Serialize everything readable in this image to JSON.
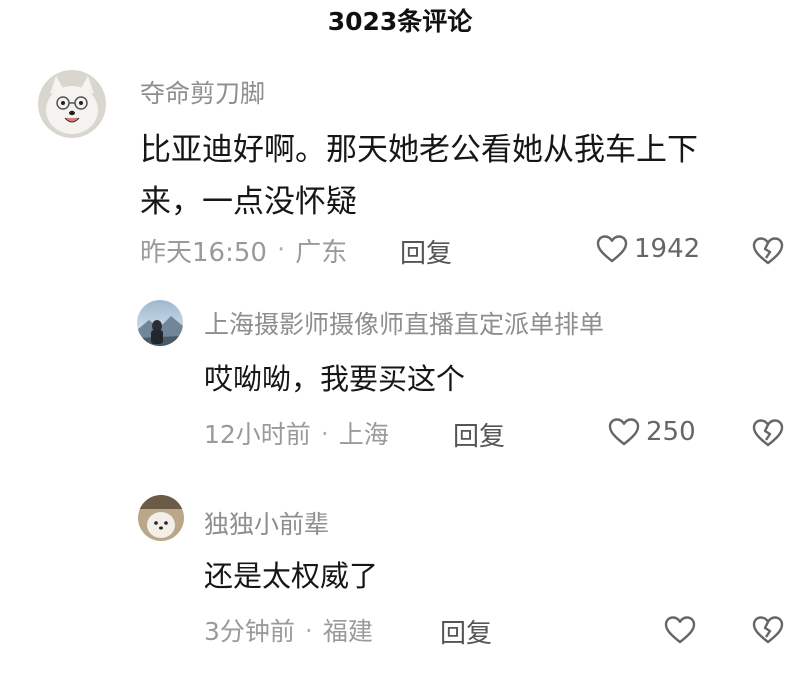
{
  "header": {
    "title": "3023条评论"
  },
  "comments": [
    {
      "username": "夺命剪刀脚",
      "lines": [
        "比亚迪好啊。那天她老公看她从我车上下",
        "来，一点没怀疑"
      ],
      "time": "昨天16:50",
      "location": "广东",
      "reply_label": "回复",
      "likes": "1942"
    },
    {
      "username": "上海摄影师摄像师直播直定派单排单",
      "lines": [
        "哎呦呦，我要买这个"
      ],
      "time": "12小时前",
      "location": "上海",
      "reply_label": "回复",
      "likes": "250"
    },
    {
      "username": "独独小前辈",
      "lines": [
        "还是太权威了"
      ],
      "time": "3分钟前",
      "location": "福建",
      "reply_label": "回复",
      "likes": ""
    }
  ],
  "separator": "·",
  "icons": {
    "like": "heart-outline-icon",
    "dislike": "broken-heart-icon"
  }
}
